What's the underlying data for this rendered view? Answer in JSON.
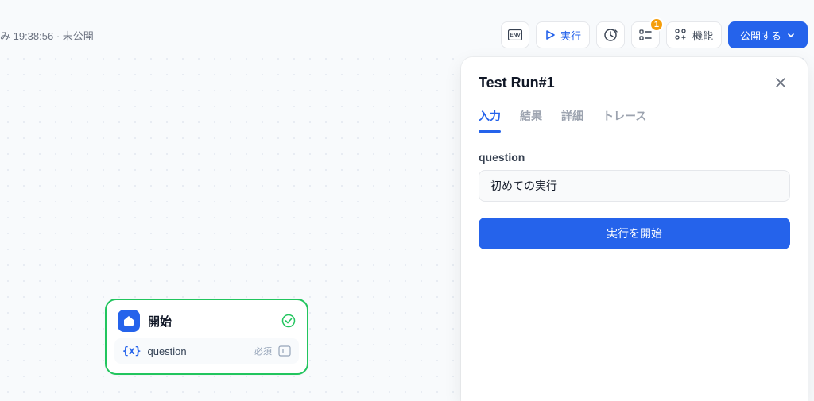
{
  "header": {
    "status_text": "み 19:38:56 · 未公開",
    "run_label": "実行",
    "features_label": "機能",
    "publish_label": "公開する",
    "badge_count": "1"
  },
  "node": {
    "title": "開始",
    "field_name": "question",
    "required_label": "必須"
  },
  "panel": {
    "title": "Test Run#1",
    "tabs": {
      "input": "入力",
      "result": "結果",
      "detail": "詳細",
      "trace": "トレース"
    },
    "input_label": "question",
    "input_value": "初めての実行",
    "start_label": "実行を開始"
  }
}
